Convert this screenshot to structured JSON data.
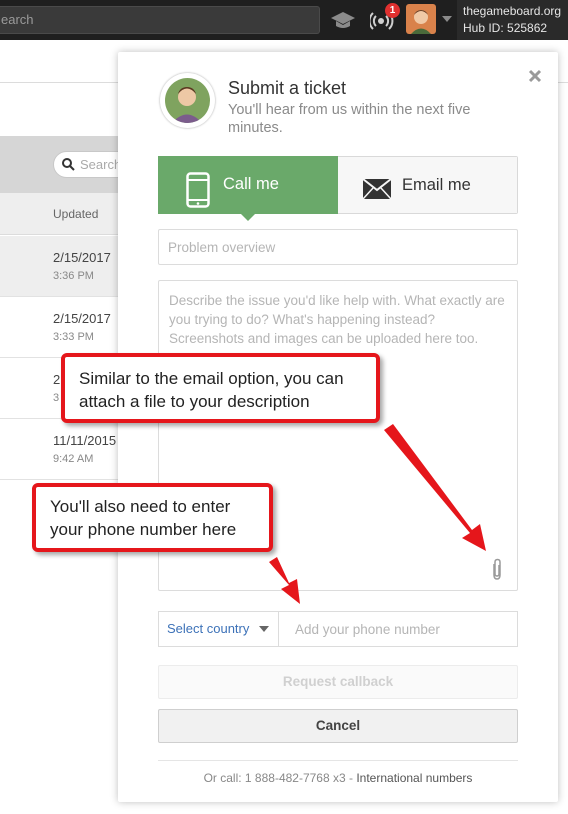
{
  "topbar": {
    "search_text": "earch",
    "notification_count": "1",
    "hub_domain": "thegameboard.org",
    "hub_id": "Hub ID: 525862"
  },
  "background": {
    "search_placeholder": "Search",
    "column_updated": "Updated",
    "rows": [
      {
        "date": "2/15/2017",
        "time": "3:36 PM"
      },
      {
        "date": "2/15/2017",
        "time": "3:33 PM"
      },
      {
        "date": "2",
        "time": "3"
      },
      {
        "date": "11/11/2015",
        "time": "9:42 AM"
      }
    ]
  },
  "panel": {
    "title": "Submit a ticket",
    "subtitle": "You'll hear from us within the next five minutes.",
    "tabs": {
      "call": "Call me",
      "email": "Email me"
    },
    "overview_placeholder": "Problem overview",
    "description_placeholder": "Describe the issue you'd like help with. What exactly are you trying to do? What's happening instead? Screenshots and images can be uploaded here too.",
    "country_select": "Select country",
    "phone_placeholder": "Add your phone number",
    "request_callback": "Request callback",
    "cancel": "Cancel",
    "footer_prefix": "Or call: 1 888-482-7768 x3 -",
    "footer_link": "International numbers"
  },
  "callouts": {
    "attach": "Similar to the email option, you can attach a file to your description",
    "phone": "You'll also need to enter your phone number here"
  },
  "colors": {
    "call_tab": "#6aa96a",
    "callout_border": "#e5161b",
    "link_blue": "#3d72b8",
    "topbar": "#1f1f1f"
  }
}
